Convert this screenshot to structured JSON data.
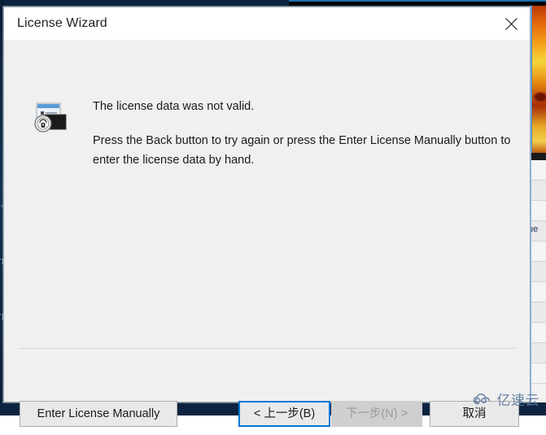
{
  "window": {
    "title": "License Wizard",
    "close_icon": "close-x-icon",
    "app_icon": "license-certificate-lock-icon"
  },
  "message": {
    "line1": "The license data was not valid.",
    "paragraph": "Press the Back button to try again or press the Enter License Manually button to enter the license data by hand."
  },
  "buttons": {
    "enter_manually": "Enter License Manually",
    "back": "< 上一步(B)",
    "next": "下一步(N) >",
    "cancel": "取消"
  },
  "states": {
    "back_focused": true,
    "next_disabled": true
  },
  "watermark": {
    "text": "亿速云",
    "icon": "cloud-icon",
    "color": "#5c7a9e"
  },
  "background": {
    "list_row_text": "ue",
    "left_glyphs": [
      "<",
      "T",
      "T"
    ]
  },
  "colors": {
    "dialog_bg": "#f0f0f0",
    "titlebar_bg": "#ffffff",
    "focus_border": "#0078d7",
    "button_bg": "#e9e9e9",
    "disabled_bg": "#cfcfcf",
    "desktop_navy": "#0d2340"
  }
}
